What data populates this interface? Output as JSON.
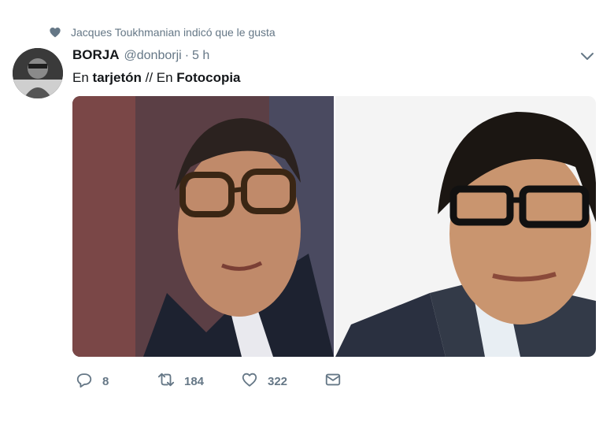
{
  "social_context": {
    "text": "Jacques Toukhmanian indicó que le gusta",
    "icon": "heart-icon"
  },
  "tweet": {
    "fullname": "BORJA",
    "username": "@donborji",
    "separator": "·",
    "time": "5 h",
    "text_parts": {
      "p1": "En ",
      "b1": "tarjetón",
      "p2": " // En ",
      "b2": "Fotocopia"
    },
    "media_count": 2
  },
  "actions": {
    "reply_count": "8",
    "retweet_count": "184",
    "like_count": "322"
  },
  "colors": {
    "text": "#14171a",
    "muted": "#657786",
    "background": "#ffffff"
  }
}
